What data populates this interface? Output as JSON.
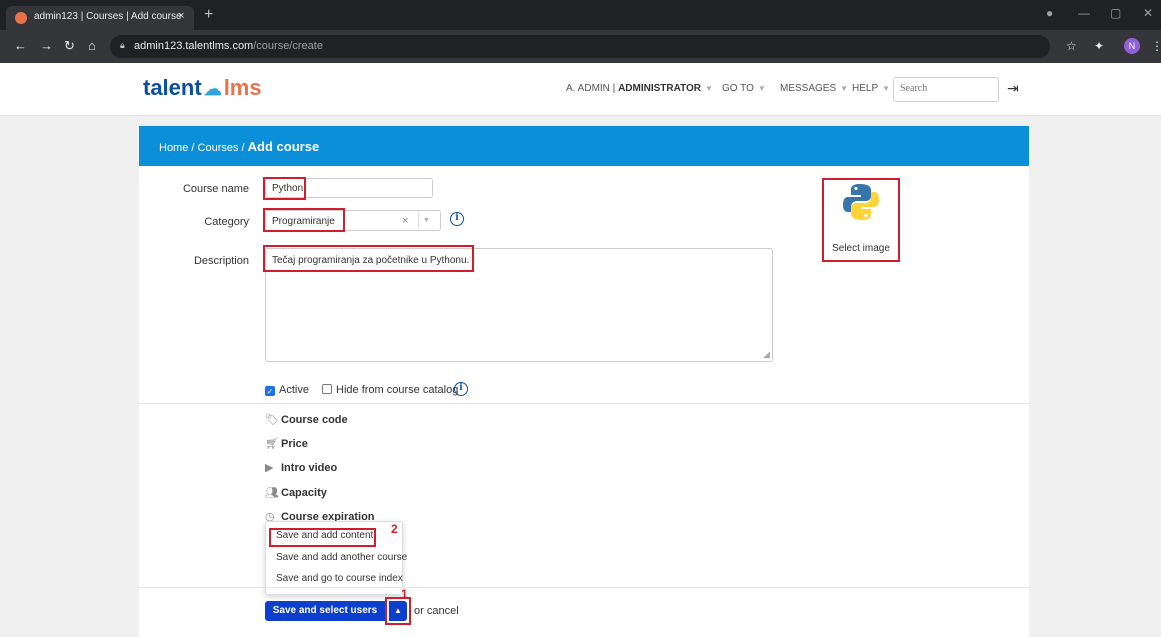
{
  "browser": {
    "tab_title": "admin123 | Courses | Add course",
    "tab_close": "×",
    "new_tab": "+",
    "url_host": "admin123.talentlms.com",
    "url_path": "/course/create",
    "profile_initial": "N"
  },
  "header": {
    "logo_talent": "talent",
    "logo_lms": "lms",
    "user_name": "A. ADMIN",
    "user_role": "ADMINISTRATOR",
    "goto": "GO TO",
    "messages": "MESSAGES",
    "help": "HELP",
    "search_placeholder": "Search"
  },
  "breadcrumb": {
    "home": "Home",
    "courses": "Courses",
    "current": "Add course",
    "sep": " / "
  },
  "form": {
    "course_name_label": "Course name",
    "course_name_value": "Python",
    "category_label": "Category",
    "category_value": "Programiranje",
    "category_clear": "×",
    "description_label": "Description",
    "description_value": "Tečaj programiranja za početnike u Pythonu.",
    "select_image": "Select image",
    "active_label": "Active",
    "active_checked": true,
    "hide_label": "Hide from course catalog",
    "hide_checked": false
  },
  "options": [
    {
      "icon": "tag-icon",
      "label": "Course code"
    },
    {
      "icon": "cart-icon",
      "label": "Price"
    },
    {
      "icon": "play-icon",
      "label": "Intro video"
    },
    {
      "icon": "users-icon",
      "label": "Capacity"
    },
    {
      "icon": "clock-icon",
      "label": "Course expiration"
    }
  ],
  "menu": {
    "items": [
      "Save and add content",
      "Save and add another course",
      "Save and go to course index"
    ]
  },
  "annotations": {
    "one": "1",
    "two": "2"
  },
  "actions": {
    "save_label": "Save and select users",
    "or": "or",
    "cancel": "cancel"
  },
  "colors": {
    "brand_blue": "#0a8fd8",
    "button_blue": "#0d3fcf",
    "annotation_red": "#d11e2e"
  }
}
